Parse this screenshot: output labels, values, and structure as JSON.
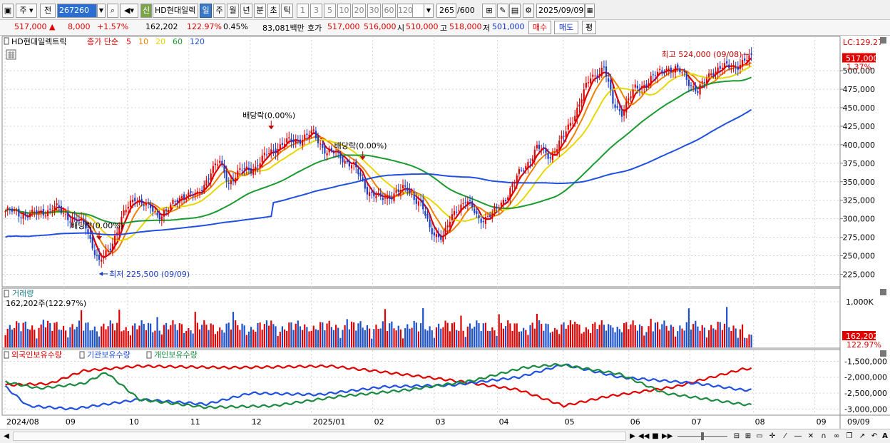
{
  "toolbar": {
    "period_week": "주",
    "period_prev": "전",
    "stock_code": "267260",
    "badge_new": "신",
    "stock_name": "HD현대일렉",
    "periods": [
      "일",
      "주",
      "월",
      "년",
      "분",
      "초",
      "틱"
    ],
    "intervals": [
      "1",
      "3",
      "5",
      "10",
      "20",
      "30",
      "60",
      "120"
    ],
    "count": "265",
    "count_max": "/600",
    "date": "2025/09/09"
  },
  "quote": {
    "price": "517,000",
    "change": "8,000",
    "change_pct": "+1.57%",
    "volume": "162,202",
    "volume_ratio": "122.97%",
    "turnover_pct": "0.45%",
    "amount": "83,081백만",
    "ask_label": "호가",
    "ask": "517,000",
    "bid": "516,000",
    "open_label": "시",
    "open": "510,000",
    "high_label": "고",
    "high": "518,000",
    "low_label": "저",
    "low": "501,000",
    "buy_button": "매수",
    "sell_button": "매도",
    "eval_button": "평"
  },
  "legend": {
    "name": "HD현대일렉트릭",
    "ma_label": "종가 단순",
    "ma": [
      {
        "label": "5",
        "color": "#e00000"
      },
      {
        "label": "10",
        "color": "#f08000"
      },
      {
        "label": "20",
        "color": "#e8d800"
      },
      {
        "label": "60",
        "color": "#1b9a30"
      },
      {
        "label": "120",
        "color": "#2050e0"
      }
    ]
  },
  "price_axis": {
    "ticks": [
      "500,000",
      "475,000",
      "450,000",
      "425,000",
      "400,000",
      "375,000",
      "350,000",
      "325,000",
      "300,000",
      "275,000",
      "250,000",
      "225,000"
    ],
    "lc_label": "LC:129.27",
    "current_price": "517,000",
    "current_pct": "1.37%"
  },
  "annotations": {
    "high": "최고 524,000 (09/08)",
    "low": "최저 225,500 (09/09)",
    "dividend": [
      "배당락(0.00%)",
      "배당락(0.00%)",
      "배당락(0.00%)"
    ]
  },
  "volume_pane": {
    "title": "거래량",
    "readout": "162,202주(122.97%)",
    "tick": "1,000K",
    "current": "162,202",
    "current_pct": "122.97%"
  },
  "holdings_pane": {
    "series": [
      {
        "label": "외국인보유수량",
        "color": "#e00000"
      },
      {
        "label": "기관보유수량",
        "color": "#2050e0"
      },
      {
        "label": "개인보유수량",
        "color": "#1b8a40"
      }
    ],
    "ticks": [
      "-1,500,000",
      "-2,000,000",
      "-2,500,000",
      "-3,000,000"
    ]
  },
  "time_axis": {
    "labels": [
      "2024/08",
      "09",
      "10",
      "11",
      "12",
      "2025/01",
      "02",
      "03",
      "04",
      "05",
      "06",
      "07",
      "08",
      "09"
    ],
    "right_label": "09/09"
  },
  "chart_data": {
    "type": "candlestick",
    "title": "HD현대일렉트릭",
    "y_range": [
      210000,
      530000
    ],
    "y_ticks": [
      225000,
      250000,
      275000,
      300000,
      325000,
      350000,
      375000,
      400000,
      425000,
      450000,
      475000,
      500000
    ],
    "close_anchors": [
      [
        0,
        310000
      ],
      [
        12,
        305000
      ],
      [
        22,
        315000
      ],
      [
        30,
        300000
      ],
      [
        36,
        290000
      ],
      [
        42,
        240000
      ],
      [
        46,
        255000
      ],
      [
        52,
        300000
      ],
      [
        58,
        330000
      ],
      [
        62,
        320000
      ],
      [
        68,
        305000
      ],
      [
        74,
        315000
      ],
      [
        80,
        335000
      ],
      [
        86,
        330000
      ],
      [
        92,
        365000
      ],
      [
        96,
        375000
      ],
      [
        100,
        350000
      ],
      [
        106,
        365000
      ],
      [
        112,
        370000
      ],
      [
        120,
        395000
      ],
      [
        128,
        405000
      ],
      [
        134,
        410000
      ],
      [
        138,
        415000
      ],
      [
        144,
        390000
      ],
      [
        150,
        385000
      ],
      [
        156,
        370000
      ],
      [
        162,
        340000
      ],
      [
        168,
        325000
      ],
      [
        174,
        335000
      ],
      [
        180,
        340000
      ],
      [
        186,
        320000
      ],
      [
        190,
        285000
      ],
      [
        196,
        275000
      ],
      [
        202,
        315000
      ],
      [
        206,
        325000
      ],
      [
        212,
        300000
      ],
      [
        218,
        305000
      ],
      [
        224,
        330000
      ],
      [
        230,
        360000
      ],
      [
        238,
        395000
      ],
      [
        244,
        385000
      ],
      [
        250,
        410000
      ],
      [
        256,
        450000
      ],
      [
        262,
        490000
      ],
      [
        268,
        505000
      ],
      [
        272,
        455000
      ],
      [
        276,
        445000
      ],
      [
        282,
        475000
      ],
      [
        290,
        490000
      ],
      [
        296,
        505000
      ],
      [
        304,
        495000
      ],
      [
        310,
        470000
      ],
      [
        316,
        500000
      ],
      [
        324,
        505000
      ],
      [
        330,
        510000
      ],
      [
        334,
        517000
      ]
    ],
    "ma_periods": [
      5,
      10,
      20,
      60,
      120
    ],
    "ma_colors": [
      "#e00000",
      "#f08000",
      "#e8d800",
      "#1b9a30",
      "#2050e0"
    ],
    "dividend_points": [
      42,
      119,
      160
    ],
    "high": {
      "value": 524000,
      "date": "09/08"
    },
    "low": {
      "value": 225500,
      "date": "09/09"
    },
    "holdings": {
      "foreign": [
        [
          0,
          -2250000
        ],
        [
          20,
          -2200000
        ],
        [
          35,
          -1800000
        ],
        [
          60,
          -1650000
        ],
        [
          100,
          -1700000
        ],
        [
          145,
          -1650000
        ],
        [
          165,
          -1800000
        ],
        [
          200,
          -2100000
        ],
        [
          230,
          -2400000
        ],
        [
          250,
          -2900000
        ],
        [
          270,
          -2600000
        ],
        [
          300,
          -2300000
        ],
        [
          330,
          -1750000
        ],
        [
          363,
          -1550000
        ]
      ],
      "institution": [
        [
          0,
          -2300000
        ],
        [
          10,
          -2900000
        ],
        [
          30,
          -3000000
        ],
        [
          60,
          -2700000
        ],
        [
          90,
          -2850000
        ],
        [
          110,
          -2500000
        ],
        [
          140,
          -2550000
        ],
        [
          170,
          -2300000
        ],
        [
          200,
          -2250000
        ],
        [
          230,
          -2000000
        ],
        [
          250,
          -1600000
        ],
        [
          275,
          -2000000
        ],
        [
          310,
          -2200000
        ],
        [
          330,
          -2400000
        ],
        [
          363,
          -2450000
        ]
      ],
      "individual": [
        [
          0,
          -2150000
        ],
        [
          15,
          -2350000
        ],
        [
          35,
          -2200000
        ],
        [
          45,
          -1850000
        ],
        [
          60,
          -2700000
        ],
        [
          90,
          -2950000
        ],
        [
          120,
          -2900000
        ],
        [
          150,
          -2600000
        ],
        [
          180,
          -2400000
        ],
        [
          210,
          -2100000
        ],
        [
          232,
          -1700000
        ],
        [
          248,
          -1600000
        ],
        [
          275,
          -1900000
        ],
        [
          295,
          -2500000
        ],
        [
          330,
          -2850000
        ],
        [
          363,
          -3050000
        ]
      ]
    }
  }
}
